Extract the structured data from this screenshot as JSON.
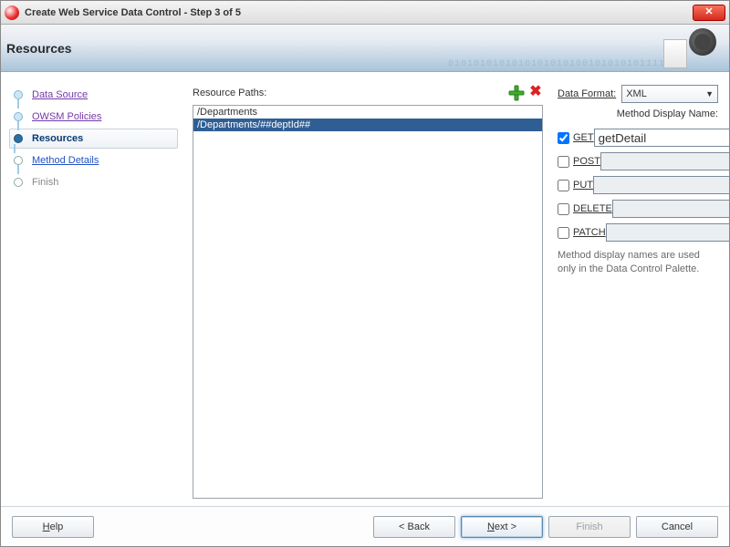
{
  "window": {
    "title": "Create Web Service Data Control - Step 3 of 5"
  },
  "banner": {
    "heading": "Resources",
    "digits": "0101010101010101010100101010101111"
  },
  "steps": {
    "items": [
      {
        "label": "Data Source",
        "state": "visited-muted"
      },
      {
        "label": "OWSM Policies",
        "state": "visited"
      },
      {
        "label": "Resources",
        "state": "current"
      },
      {
        "label": "Method Details",
        "state": "future"
      },
      {
        "label": "Finish",
        "state": "disabled"
      }
    ]
  },
  "center": {
    "paths_label": "Resource Paths:",
    "add_icon": "plus-icon",
    "delete_icon": "delete-icon",
    "items": [
      {
        "text": "/Departments",
        "selected": false
      },
      {
        "text": "/Departments/##deptId##",
        "selected": true
      }
    ]
  },
  "right": {
    "data_format_label": "Data Format:",
    "data_format_value": "XML",
    "section_title": "Method Display Name:",
    "methods": [
      {
        "key": "get",
        "label": "GET",
        "checked": true,
        "name": "getDetail",
        "enabled": true
      },
      {
        "key": "post",
        "label": "POST",
        "checked": false,
        "name": "",
        "enabled": false
      },
      {
        "key": "put",
        "label": "PUT",
        "checked": false,
        "name": "",
        "enabled": false
      },
      {
        "key": "delete",
        "label": "DELETE",
        "checked": false,
        "name": "",
        "enabled": false
      },
      {
        "key": "patch",
        "label": "PATCH",
        "checked": false,
        "name": "",
        "enabled": false
      }
    ],
    "helper": "Method display names are used only in the Data Control Palette."
  },
  "footer": {
    "help": "Help",
    "back": "< Back",
    "next": "Next >",
    "finish": "Finish",
    "cancel": "Cancel"
  }
}
